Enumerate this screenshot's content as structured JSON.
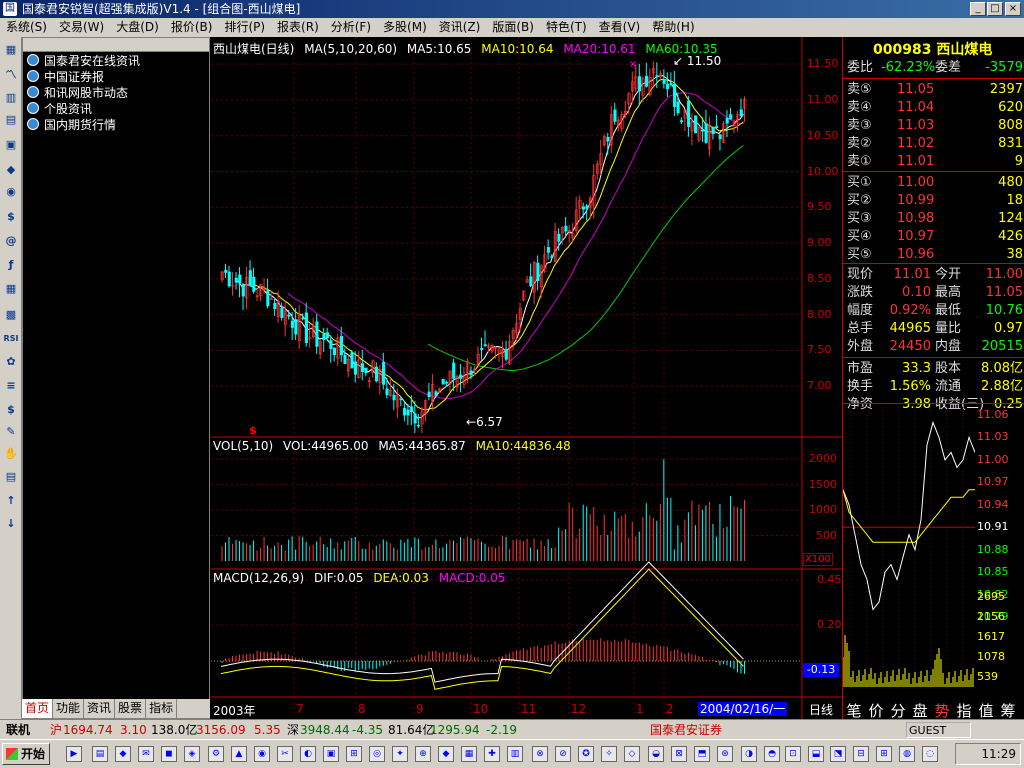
{
  "window": {
    "title": "国泰君安锐智(超强集成版)V1.4 - [组合图-西山煤电]"
  },
  "menu": [
    "系统(S)",
    "交易(W)",
    "大盘(D)",
    "报价(B)",
    "排行(P)",
    "报表(R)",
    "分析(F)",
    "多股(M)",
    "资讯(Z)",
    "版面(B)",
    "特色(T)",
    "查看(V)",
    "帮助(H)"
  ],
  "news": {
    "items": [
      "国泰君安在线资讯",
      "中国证券报",
      "和讯网股市动态",
      "个股资讯",
      "国内期货行情"
    ]
  },
  "panel_tabs": [
    "首页",
    "功能",
    "资讯",
    "股票",
    "指标"
  ],
  "chart": {
    "kline_header": {
      "title": "西山煤电(日线)",
      "ma": "MA(5,10,20,60)",
      "ma5": "MA5:10.65",
      "ma10": "MA10:10.64",
      "ma20": "MA20:10.61",
      "ma60": "MA60:10.35"
    },
    "price_ticks": [
      "11.50",
      "11.00",
      "10.50",
      "10.00",
      "9.50",
      "9.00",
      "8.50",
      "8.00",
      "7.50",
      "7.00"
    ],
    "high_label": "11.50",
    "low_label": "6.57",
    "dollar": "$",
    "vol_header": {
      "name": "VOL(5,10)",
      "vol": "VOL:44965.00",
      "ma5": "MA5:44365.87",
      "ma10": "MA10:44836.48"
    },
    "vol_ticks": [
      "2000",
      "1500",
      "1000",
      "500"
    ],
    "vol_unit": "X100",
    "macd_header": {
      "name": "MACD(12,26,9)",
      "dif": "DIF:0.05",
      "dea": "DEA:0.03",
      "macd": "MACD:0.05"
    },
    "macd_ticks": [
      "0.45",
      "0.20"
    ],
    "macd_cur": "-0.13",
    "x_labels": [
      "2003年",
      "7",
      "8",
      "9",
      "10",
      "11",
      "12",
      "1",
      "2"
    ],
    "date_box": "2004/02/16/一",
    "period": "日线",
    "chart_data": {
      "type": "candlestick",
      "approx_close": [
        8.6,
        8.4,
        8.3,
        8.0,
        7.7,
        7.6,
        7.3,
        7.2,
        6.8,
        6.6,
        7.0,
        7.2,
        7.4,
        7.5,
        8.4,
        8.9,
        9.2,
        9.8,
        10.8,
        11.2,
        11.5,
        10.9,
        10.6,
        10.5,
        11.01
      ],
      "high": 11.5,
      "low": 6.57,
      "ylim": [
        6.5,
        11.6
      ]
    }
  },
  "quote": {
    "code": "000983",
    "name": "西山煤电",
    "webi_label": "委比",
    "webi": "-62.23%",
    "wecha_label": "委差",
    "wecha": "-3579",
    "sells": [
      {
        "l": "卖⑤",
        "p": "11.05",
        "v": "2397"
      },
      {
        "l": "卖④",
        "p": "11.04",
        "v": "620"
      },
      {
        "l": "卖③",
        "p": "11.03",
        "v": "808"
      },
      {
        "l": "卖②",
        "p": "11.02",
        "v": "831"
      },
      {
        "l": "卖①",
        "p": "11.01",
        "v": "9"
      }
    ],
    "buys": [
      {
        "l": "买①",
        "p": "11.00",
        "v": "480"
      },
      {
        "l": "买②",
        "p": "10.99",
        "v": "18"
      },
      {
        "l": "买③",
        "p": "10.98",
        "v": "124"
      },
      {
        "l": "买④",
        "p": "10.97",
        "v": "426"
      },
      {
        "l": "买⑤",
        "p": "10.96",
        "v": "38"
      }
    ],
    "stats": [
      {
        "l1": "现价",
        "v1": "11.01",
        "l2": "今开",
        "v2": "11.00"
      },
      {
        "l1": "涨跌",
        "v1": "0.10",
        "l2": "最高",
        "v2": "11.05"
      },
      {
        "l1": "幅度",
        "v1": "0.92%",
        "l2": "最低",
        "v2": "10.76"
      },
      {
        "l1": "总手",
        "v1": "44965",
        "l2": "量比",
        "v2": "0.97"
      },
      {
        "l1": "外盘",
        "v1": "24450",
        "l2": "内盘",
        "v2": "20515"
      },
      {
        "l1": "市盈",
        "v1": "33.3",
        "l2": "股本",
        "v2": "8.08亿"
      },
      {
        "l1": "换手",
        "v1": "1.56%",
        "l2": "流通",
        "v2": "2.88亿"
      },
      {
        "l1": "净资",
        "v1": "3.98",
        "l2": "收益(三)",
        "v2": "0.25"
      }
    ],
    "intraday_ticks": [
      "11.06",
      "11.03",
      "11.00",
      "10.97",
      "10.94",
      "10.91",
      "10.88",
      "10.85",
      "10.82",
      "10.79"
    ],
    "vol_ticks": [
      "2695",
      "2156",
      "1617",
      "1078",
      "539"
    ],
    "bottom_tabs": [
      "笔",
      "价",
      "分",
      "盘",
      "势",
      "指",
      "值",
      "筹"
    ]
  },
  "status": {
    "lianji": "联机",
    "sh_label": "沪",
    "sh_index": "1694.74",
    "sh_chg": "3.10",
    "sh_amt": "138.0亿",
    "sh_amt2": "3156.09",
    "sh_chg2": "5.35",
    "sz_label": "深",
    "sz_index": "3948.44",
    "sz_chg": "-4.35",
    "sz_amt": "81.64亿",
    "sz_amt2": "1295.94",
    "sz_chg2": "-2.19",
    "broker": "国泰君安证券",
    "user": "GUEST"
  },
  "taskbar": {
    "start": "开始",
    "time": "11:29"
  }
}
